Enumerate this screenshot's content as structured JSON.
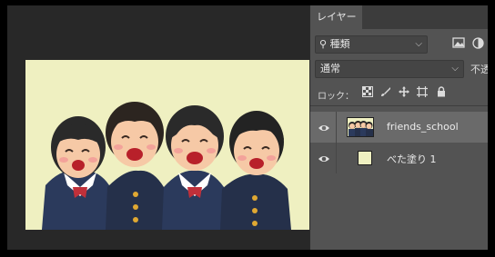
{
  "panel": {
    "tab_label": "レイヤー",
    "filter": {
      "label": "種類",
      "search_icon": "search-icon",
      "chevron": "⌄"
    },
    "filter_icons": [
      "image-filter-icon",
      "adjustment-filter-icon"
    ],
    "blend_mode": {
      "value": "通常"
    },
    "opacity_label": "不透",
    "lock": {
      "label": "ロック：",
      "icons": [
        "lock-transparent-icon",
        "lock-paint-icon",
        "lock-position-icon",
        "lock-artboard-icon",
        "lock-all-icon"
      ]
    },
    "layers": [
      {
        "name": "friends_school",
        "visible": true,
        "selected": true,
        "thumb": "image"
      },
      {
        "name": "べた塗り 1",
        "visible": true,
        "selected": false,
        "thumb": "fill",
        "fill_color": "#eff0c1"
      }
    ]
  },
  "canvas": {
    "background": "#eff0c1"
  }
}
